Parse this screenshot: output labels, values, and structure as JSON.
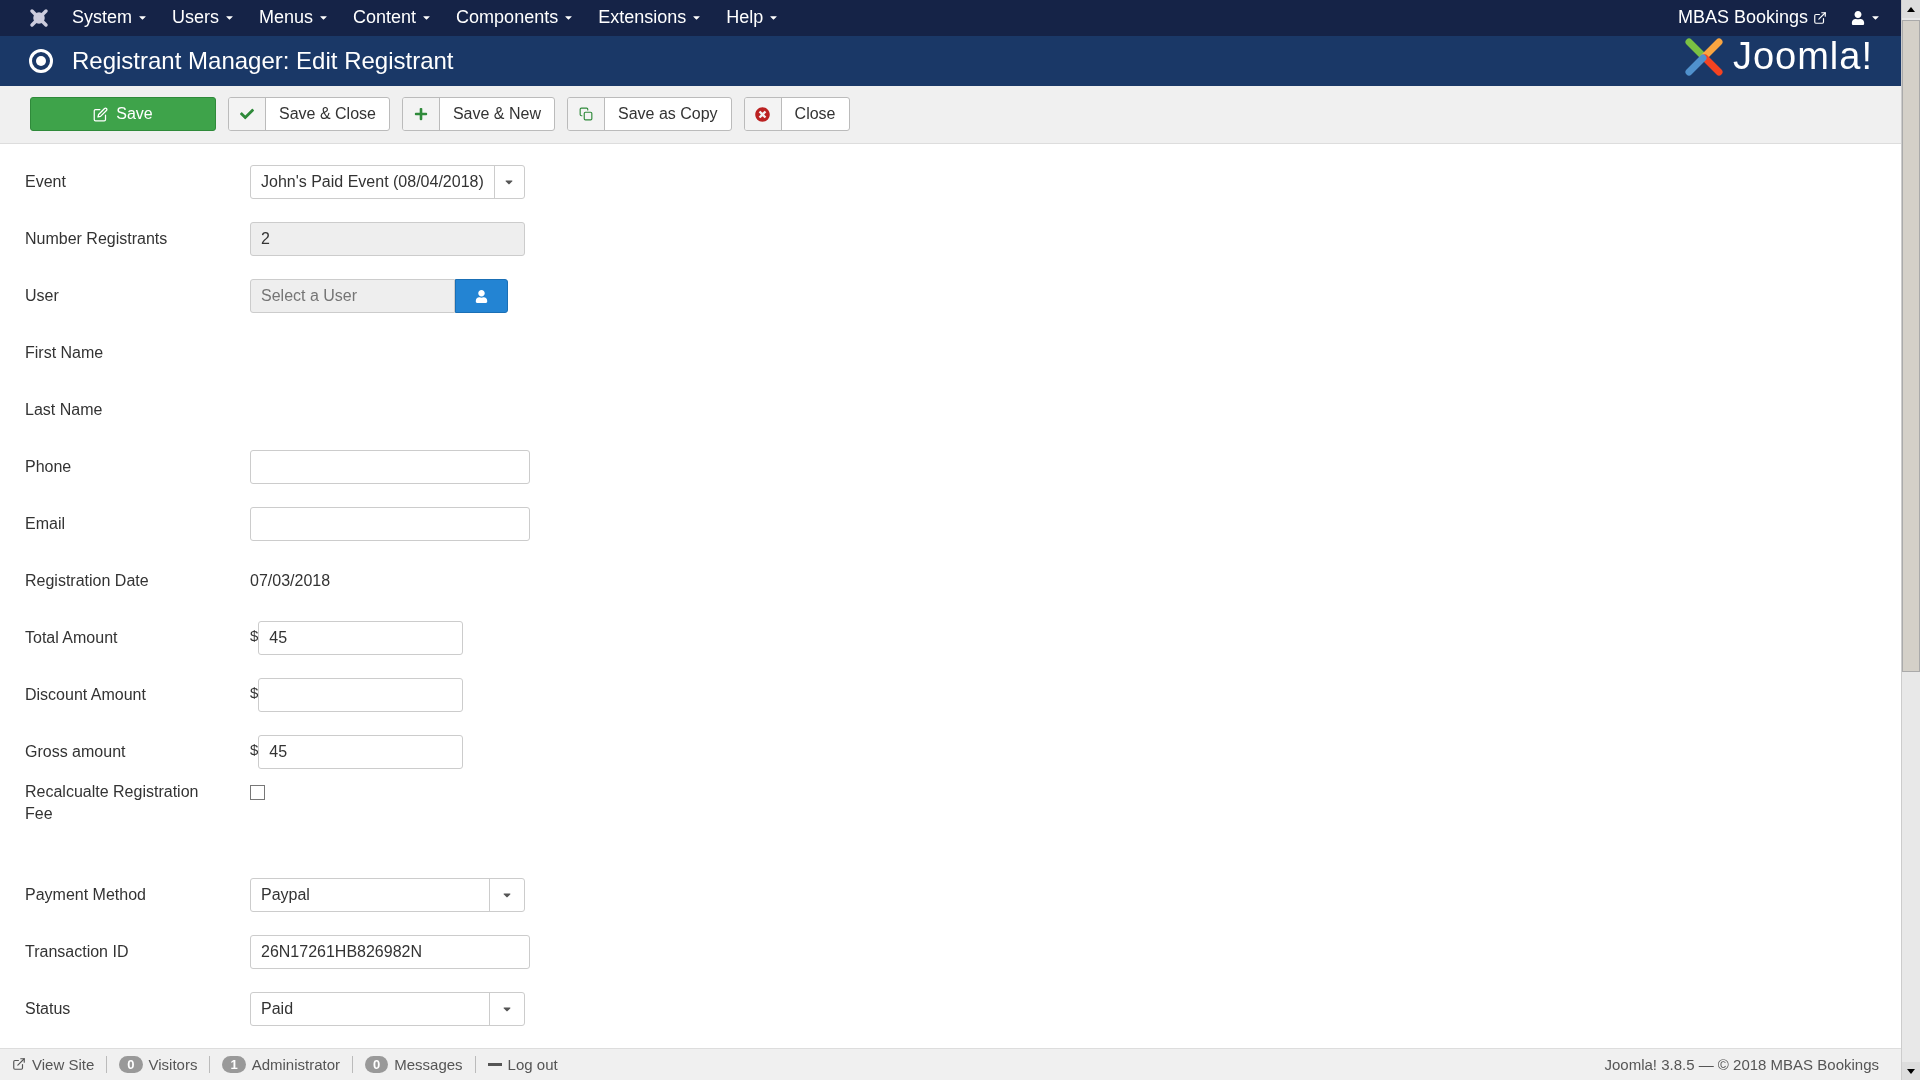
{
  "menu": [
    "System",
    "Users",
    "Menus",
    "Content",
    "Components",
    "Extensions",
    "Help"
  ],
  "site_link": "MBAS Bookings",
  "page_title": "Registrant Manager: Edit Registrant",
  "logo_text": "Joomla!",
  "toolbar": [
    {
      "kind": "primary",
      "label": "Save"
    },
    {
      "kind": "check",
      "label": "Save & Close"
    },
    {
      "kind": "plus",
      "label": "Save & New"
    },
    {
      "kind": "copy",
      "label": "Save as Copy"
    },
    {
      "kind": "close",
      "label": "Close"
    }
  ],
  "fields": [
    {
      "kind": "select",
      "label": "Event",
      "value": "John's Paid Event (08/04/2018)"
    },
    {
      "kind": "readonly",
      "label": "Number Registrants",
      "value": "2"
    },
    {
      "kind": "user",
      "label": "User",
      "placeholder": "Select a User"
    },
    {
      "kind": "empty",
      "label": "First Name"
    },
    {
      "kind": "empty",
      "label": "Last Name"
    },
    {
      "kind": "input",
      "label": "Phone"
    },
    {
      "kind": "input",
      "label": "Email"
    },
    {
      "kind": "static",
      "label": "Registration Date",
      "value": "07/03/2018"
    },
    {
      "kind": "money",
      "label": "Total Amount",
      "prefix": "$",
      "value": "45"
    },
    {
      "kind": "money",
      "label": "Discount Amount",
      "prefix": "$"
    },
    {
      "kind": "money",
      "label": "Gross amount",
      "prefix": "$",
      "value": "45"
    },
    {
      "kind": "checkbox",
      "label": "Recalcualte Registration Fee",
      "checked": false
    },
    {
      "kind": "select",
      "label": "Payment Method",
      "value": "Paypal"
    },
    {
      "kind": "input",
      "label": "Transaction ID",
      "value": "26N17261HB826982N"
    },
    {
      "kind": "select",
      "label": "Status",
      "value": "Paid"
    }
  ],
  "status_bar": {
    "view_site": "View Site",
    "counters": [
      {
        "count": "0",
        "label": "Visitors"
      },
      {
        "count": "1",
        "label": "Administrator"
      },
      {
        "count": "0",
        "label": "Messages"
      }
    ],
    "logout": "Log out",
    "version": "Joomla! 3.8.5",
    "separator": "—",
    "copyright": "© 2018 MBAS Bookings"
  }
}
